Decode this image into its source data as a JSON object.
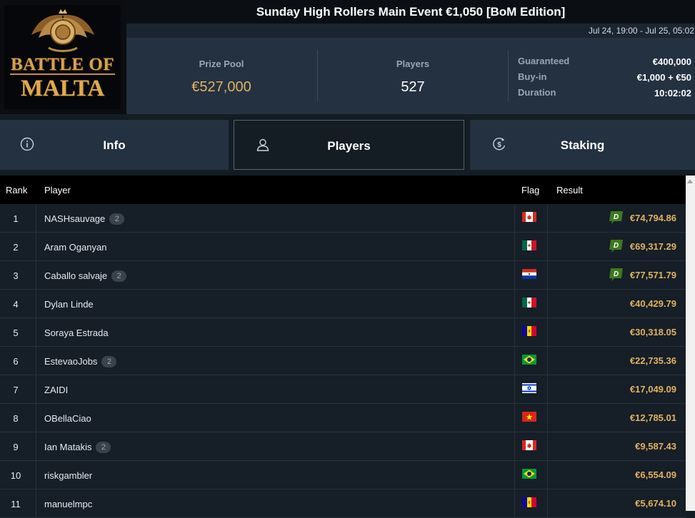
{
  "logo": {
    "line1": "BATTLE OF",
    "line2": "MALTA"
  },
  "tournament": {
    "title": "Sunday High Rollers Main Event €1,050 [BoM Edition]",
    "dates": "Jul 24, 19:00 - Jul 25, 05:02"
  },
  "stats": {
    "prize_pool_label": "Prize Pool",
    "prize_pool_value": "€527,000",
    "players_label": "Players",
    "players_value": "527",
    "guaranteed_label": "Guaranteed",
    "guaranteed_value": "€400,000",
    "buyin_label": "Buy-in",
    "buyin_value": "€1,000 + €50",
    "duration_label": "Duration",
    "duration_value": "10:02:02"
  },
  "tabs": [
    {
      "label": "Info",
      "icon": "info-icon"
    },
    {
      "label": "Players",
      "icon": "user-icon",
      "active": true
    },
    {
      "label": "Staking",
      "icon": "dollar-coin-icon"
    }
  ],
  "table": {
    "headers": {
      "rank": "Rank",
      "player": "Player",
      "flag": "Flag",
      "result": "Result"
    },
    "rows": [
      {
        "rank": "1",
        "name": "NASHsauvage",
        "badge": "2",
        "flag": "ca",
        "staked": true,
        "result": "€74,794.86"
      },
      {
        "rank": "2",
        "name": "Aram Oganyan",
        "badge": "",
        "flag": "mx",
        "staked": true,
        "result": "€69,317.29"
      },
      {
        "rank": "3",
        "name": "Caballo salvaje",
        "badge": "2",
        "flag": "py",
        "staked": true,
        "result": "€77,571.79"
      },
      {
        "rank": "4",
        "name": "Dylan Linde",
        "badge": "",
        "flag": "mx",
        "staked": false,
        "result": "€40,429.79"
      },
      {
        "rank": "5",
        "name": "Soraya Estrada",
        "badge": "",
        "flag": "ad",
        "staked": false,
        "result": "€30,318.05"
      },
      {
        "rank": "6",
        "name": "EstevaoJobs",
        "badge": "2",
        "flag": "br",
        "staked": false,
        "result": "€22,735.36"
      },
      {
        "rank": "7",
        "name": "ZAIDI",
        "badge": "",
        "flag": "il",
        "staked": false,
        "result": "€17,049.09"
      },
      {
        "rank": "8",
        "name": "OBellaCiao",
        "badge": "",
        "flag": "vn",
        "staked": false,
        "result": "€12,785.01"
      },
      {
        "rank": "9",
        "name": "Ian Matakis",
        "badge": "2",
        "flag": "ca",
        "staked": false,
        "result": "€9,587.43"
      },
      {
        "rank": "10",
        "name": "riskgambler",
        "badge": "",
        "flag": "br",
        "staked": false,
        "result": "€6,554.09"
      },
      {
        "rank": "11",
        "name": "manuelmpc",
        "badge": "",
        "flag": "ad",
        "staked": false,
        "result": "€5,674.10"
      }
    ]
  },
  "colors": {
    "accent_gold": "#e1b35e",
    "stake_green": "#3d7a1f",
    "panel": "#243140",
    "background": "#141c24"
  }
}
